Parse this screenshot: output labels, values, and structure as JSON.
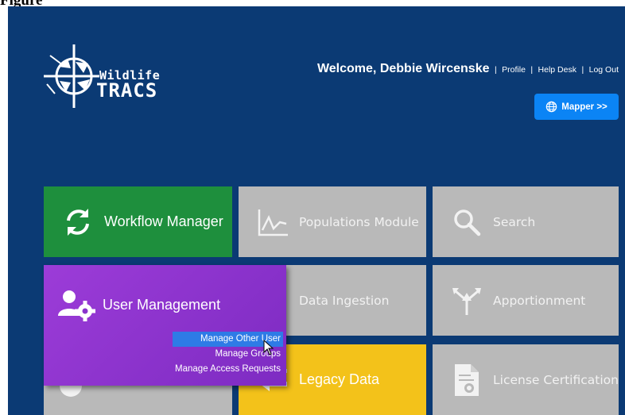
{
  "figure": {
    "label": "Figure"
  },
  "header": {
    "logo_line1": "Wildlife",
    "logo_line2": "TRACS",
    "welcome": "Welcome, Debbie Wircenske",
    "links": [
      "Profile",
      "Help Desk",
      "Log Out"
    ],
    "separator": "|",
    "mapper_label": "Mapper >>"
  },
  "tiles": {
    "workflow": "Workflow Manager",
    "populations": "Populations Module",
    "search": "Search",
    "data_ingestion": "Data Ingestion",
    "apportionment": "Apportionment",
    "legacy": "Legacy Data",
    "license": "License Certification"
  },
  "user_management": {
    "label": "User Management",
    "menu": [
      "Manage Other User",
      "Manage Groups",
      "Manage Access Requests"
    ],
    "highlighted_index": 0
  },
  "colors": {
    "background": "#0b3a74",
    "green_tile": "#1e8f3d",
    "gray_tile": "#b9b9b9",
    "yellow_tile": "#f3c21a",
    "purple_tile": "#8a33cc",
    "mapper_button": "#0b84f5",
    "menu_highlight": "#2e7be6"
  },
  "icons": {
    "workflow": "refresh-arrows-icon",
    "populations": "line-chart-icon",
    "search": "magnifier-icon",
    "apportionment": "split-arrows-icon",
    "legacy": "arrow-left-icon",
    "license": "certificate-document-icon",
    "user_management": "user-gear-icon",
    "mapper": "globe-icon"
  }
}
